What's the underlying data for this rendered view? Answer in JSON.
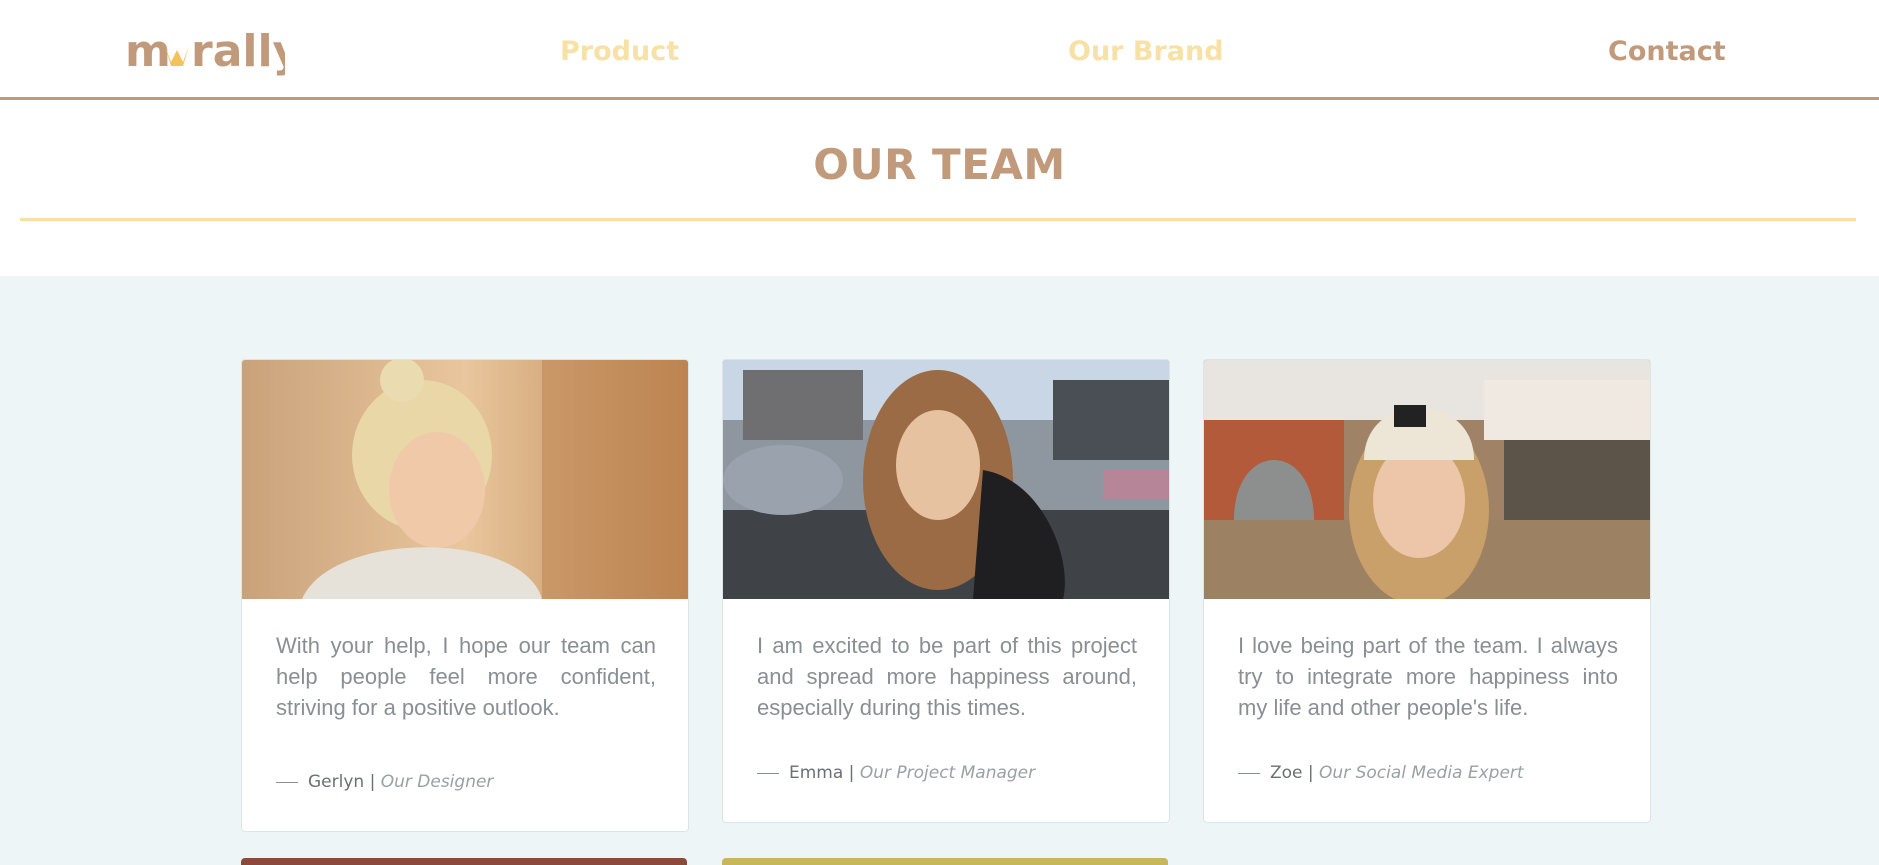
{
  "nav": {
    "logo": "morally",
    "items": [
      "Product",
      "Our Brand",
      "Contact"
    ]
  },
  "page": {
    "title": "OUR TEAM"
  },
  "team": [
    {
      "quote": "With your help, I hope our team can help people feel more confident, striving for a positive outlook.",
      "name": "Gerlyn |",
      "role": "Our Designer"
    },
    {
      "quote": "I am excited to be part of this project and spread more happiness around, especially during this times.",
      "name": "Emma |",
      "role": "Our Project Manager"
    },
    {
      "quote": "I love being part of the team. I always try to integrate more happiness into my life and other people's life.",
      "name": "Zoe |",
      "role": "Our Social Media Expert"
    }
  ],
  "colors": {
    "brand": "#c19a7c",
    "accent": "#f7e1a4",
    "band": "#eef5f7"
  }
}
